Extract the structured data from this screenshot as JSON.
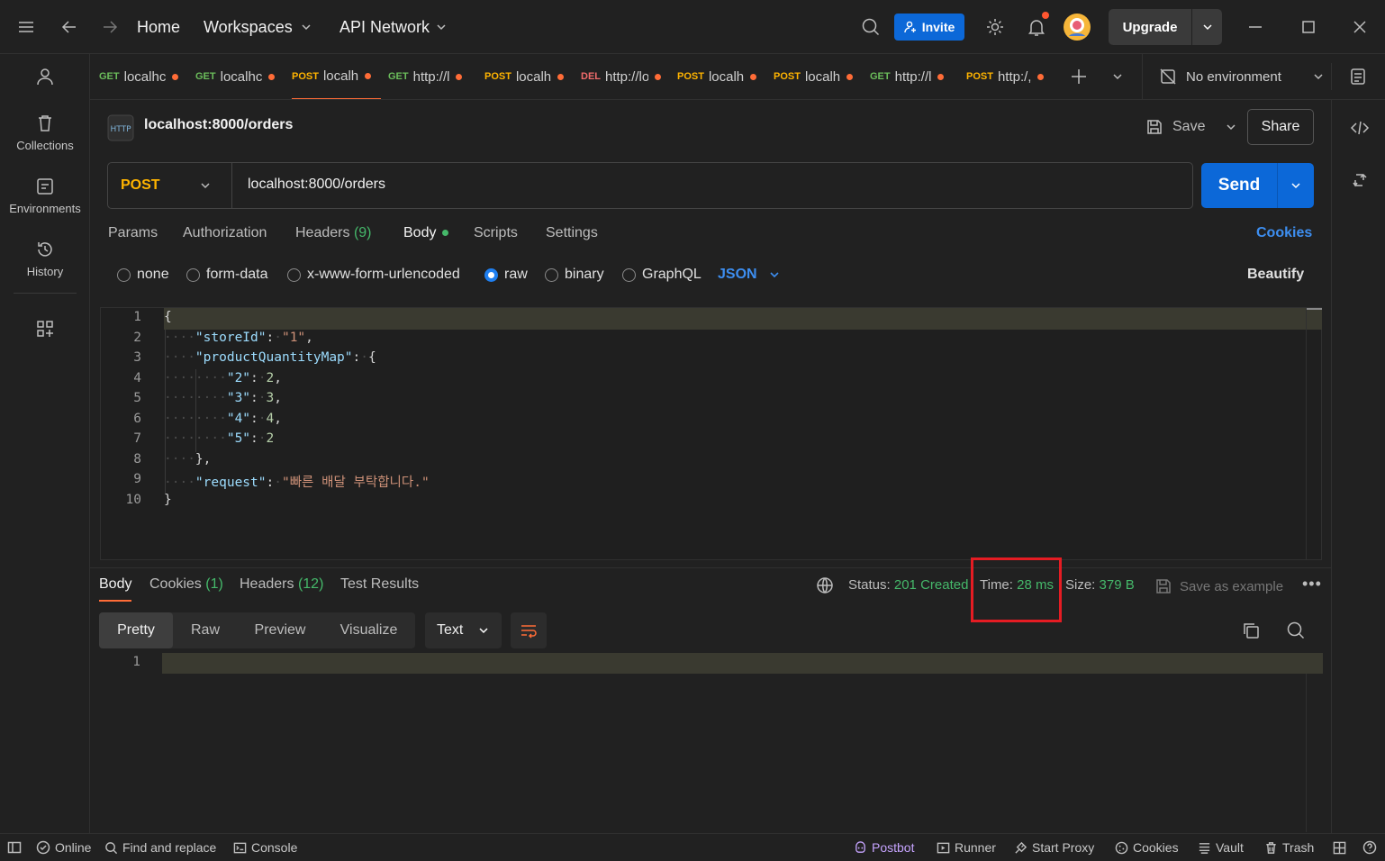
{
  "titlebar": {
    "home": "Home",
    "workspaces": "Workspaces",
    "api_network": "API Network",
    "invite": "Invite",
    "upgrade": "Upgrade"
  },
  "sidebar": {
    "items": [
      {
        "label": "Collections"
      },
      {
        "label": "Environments"
      },
      {
        "label": "History"
      }
    ]
  },
  "tabs": [
    {
      "method": "GET",
      "title": "localhc",
      "color": "#6bbd5b"
    },
    {
      "method": "GET",
      "title": "localhc",
      "color": "#6bbd5b"
    },
    {
      "method": "POST",
      "title": "localh",
      "color": "#ffb400",
      "active": true
    },
    {
      "method": "GET",
      "title": "http://l",
      "color": "#6bbd5b"
    },
    {
      "method": "POST",
      "title": "localh",
      "color": "#ffb400"
    },
    {
      "method": "DEL",
      "title": "http://lo",
      "color": "#f06b6b"
    },
    {
      "method": "POST",
      "title": "localh",
      "color": "#ffb400"
    },
    {
      "method": "POST",
      "title": "localh",
      "color": "#ffb400"
    },
    {
      "method": "GET",
      "title": "http://l",
      "color": "#6bbd5b"
    },
    {
      "method": "POST",
      "title": "http:/,",
      "color": "#ffb400"
    }
  ],
  "environment": "No environment",
  "request": {
    "title": "localhost:8000/orders",
    "save": "Save",
    "share": "Share",
    "method": "POST",
    "url": "localhost:8000/orders",
    "send": "Send"
  },
  "req_tabs": {
    "params": "Params",
    "authorization": "Authorization",
    "headers": "Headers",
    "headers_count": "(9)",
    "body": "Body",
    "scripts": "Scripts",
    "settings": "Settings",
    "cookies": "Cookies"
  },
  "body_types": {
    "none": "none",
    "form_data": "form-data",
    "urlencoded": "x-www-form-urlencoded",
    "raw": "raw",
    "binary": "binary",
    "graphql": "GraphQL",
    "json": "JSON",
    "beautify": "Beautify"
  },
  "editor": {
    "line_numbers": [
      "1",
      "2",
      "3",
      "4",
      "5",
      "6",
      "7",
      "8",
      "9",
      "10"
    ],
    "store_key": "\"storeId\"",
    "store_val": "\"1\"",
    "pqm_key": "\"productQuantityMap\"",
    "k2": "\"2\"",
    "v2": "2",
    "k3": "\"3\"",
    "v3": "3",
    "k4": "\"4\"",
    "v4": "4",
    "k5": "\"5\"",
    "v5": "2",
    "req_key": "\"request\"",
    "req_val": "\"빠른 배달 부탁합니다.\""
  },
  "response": {
    "tabs": {
      "body": "Body",
      "cookies": "Cookies",
      "cookies_count": "(1)",
      "headers": "Headers",
      "headers_count": "(12)",
      "test_results": "Test Results"
    },
    "status_label": "Status:",
    "status_value": "201 Created",
    "time_label": "Time:",
    "time_value": "28 ms",
    "size_label": "Size:",
    "size_value": "379 B",
    "save_example": "Save as example",
    "views": [
      "Pretty",
      "Raw",
      "Preview",
      "Visualize"
    ],
    "format": "Text",
    "line_number": "1"
  },
  "statusbar": {
    "online": "Online",
    "find_replace": "Find and replace",
    "console": "Console",
    "postbot": "Postbot",
    "runner": "Runner",
    "start_proxy": "Start Proxy",
    "cookies": "Cookies",
    "vault": "Vault",
    "trash": "Trash"
  },
  "colors": {
    "accent": "#ff6c37",
    "primary_button": "#0c68d8",
    "success": "#45b86a",
    "highlight_box": "#e51c23"
  }
}
